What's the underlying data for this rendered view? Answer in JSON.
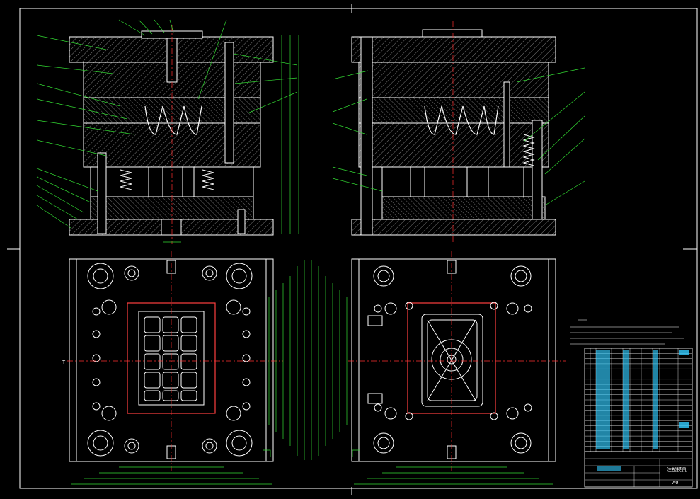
{
  "drawing": {
    "title_block": {
      "name": "注塑模具",
      "sheet": "A0"
    },
    "views": [
      "front-section",
      "side-section",
      "moving-half-plan",
      "fixed-half-plan"
    ],
    "section_marks": [
      "T",
      "T"
    ],
    "colors": {
      "background": "#000000",
      "outline": "#ffffff",
      "hatch": "#b0b0b0",
      "dimension": "#33dd33",
      "centerline": "#ff3030",
      "bom_cells": "#33ccff",
      "frame": "#ffffff"
    },
    "bom_rows": 20
  }
}
